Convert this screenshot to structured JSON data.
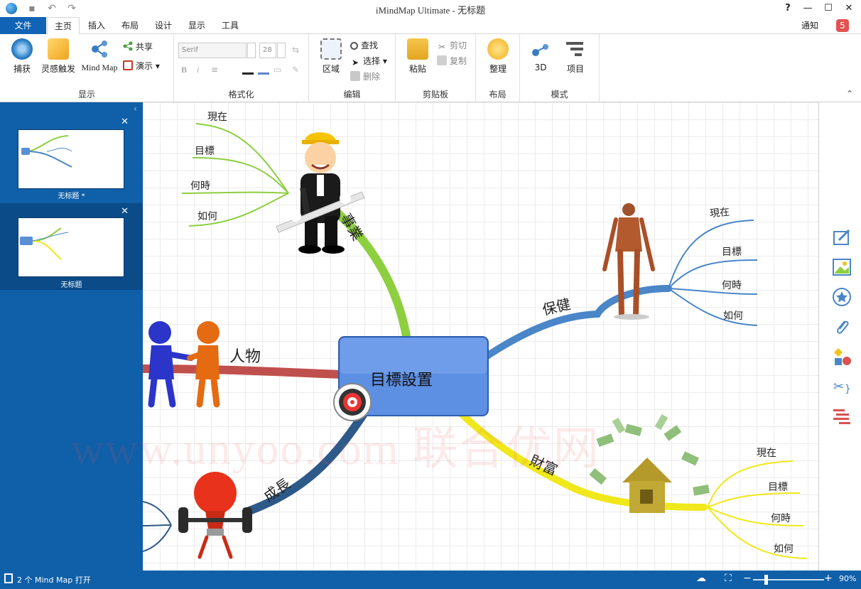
{
  "window": {
    "title": "iMindMap Ultimate - 无标题",
    "help": "?",
    "minimize": "—",
    "maximize": "☐",
    "close": "✕"
  },
  "quick_access": {
    "save": "▪",
    "undo": "↶",
    "redo": "↷"
  },
  "tabs": [
    {
      "label": "文件"
    },
    {
      "label": "主页"
    },
    {
      "label": "插入"
    },
    {
      "label": "布局"
    },
    {
      "label": "设计"
    },
    {
      "label": "显示"
    },
    {
      "label": "工具"
    }
  ],
  "notifications": {
    "label": "通知",
    "count": "5"
  },
  "ribbon": {
    "show": {
      "label": "显示",
      "capture": "捕获",
      "inspire": "灵感触发",
      "mindmap": "Mind Map",
      "share": "共享",
      "present": "演示 ▾"
    },
    "format": {
      "label": "格式化",
      "font": "Serif",
      "size": "28",
      "bold": "B",
      "italic": "i"
    },
    "edit": {
      "label": "编辑",
      "region": "区域",
      "find": "查找",
      "select": "选择 ▾",
      "delete": "删除"
    },
    "clipboard": {
      "label": "剪贴板",
      "paste": "粘贴",
      "cut": "剪切",
      "copy": "复制"
    },
    "layout": {
      "label": "布局",
      "arrange": "整理"
    },
    "mode": {
      "label": "模式",
      "three_d": "3D",
      "project": "项目"
    }
  },
  "left_panel": {
    "maps": [
      {
        "caption": "无标题 *"
      },
      {
        "caption": "无标题"
      }
    ],
    "close": "✕"
  },
  "mindmap": {
    "central": "目標設置",
    "branches": {
      "career": "事業",
      "health": "保健",
      "people": "人物",
      "growth": "成長",
      "wealth": "財富"
    },
    "career_subs": [
      "現在",
      "目標",
      "何時",
      "如何"
    ],
    "health_subs": [
      "現在",
      "目標",
      "何時",
      "如何"
    ],
    "wealth_subs": [
      "現在",
      "目標",
      "何時",
      "如何"
    ],
    "colors": {
      "career": "#8dcf3f",
      "health": "#4a86c8",
      "people": "#c0504d",
      "growth": "#2e5a8a",
      "wealth": "#f0e81a"
    }
  },
  "watermark": "www.unyoo.com 联合优网",
  "status": {
    "open_maps": "2 个 Mind Map 打开",
    "zoom": "90%"
  }
}
